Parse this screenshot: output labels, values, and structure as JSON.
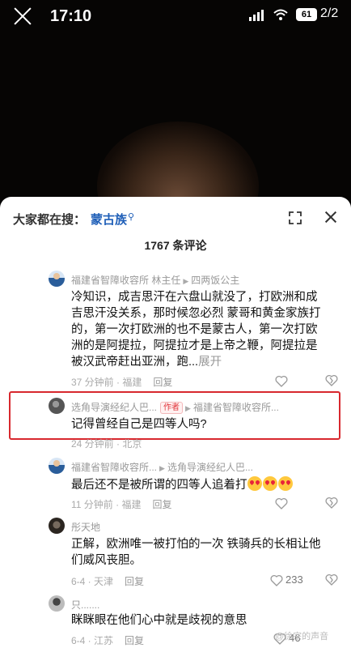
{
  "status_bar": {
    "time": "17:10",
    "battery": "61",
    "page_indicator": "2/2"
  },
  "sheet": {
    "search_label": "大家都在搜：",
    "search_term": "蒙古族",
    "comment_count": "1767 条评论"
  },
  "comments": [
    {
      "user": "福建省智障收容所 林主任",
      "reply_to": "四两饭公主",
      "lines": [
        "冷知识，成吉思汗在六盘山就没了，打欧洲和成",
        "吉思汗没关系，那时候忽必烈 蒙哥和黄金家族打",
        "的，第一次打欧洲的也不是蒙古人，第一次打欧",
        "洲的是阿提拉，阿提拉才是上帝之鞭，阿提拉是",
        "被汉武帝赶出亚洲，跑..."
      ],
      "expand": "展开",
      "time_loc": "37 分钟前 · 福建",
      "reply": "回复"
    },
    {
      "user": "选角导演经纪人巴...",
      "tag": "作者",
      "reply_to": "福建省智障收容所...",
      "text": "记得曾经自己是四等人吗?",
      "time_loc": "24 分钟前 · 北京"
    },
    {
      "user": "福建省智障收容所...",
      "reply_to": "选角导演经纪人巴...",
      "text": "最后还不是被所谓的四等人追着打",
      "time_loc": "11 分钟前 · 福建",
      "reply": "回复"
    },
    {
      "user": "彤天地",
      "lines": [
        "正解，欧洲唯一被打怕的一次 铁骑兵的长相让他",
        "们威风丧胆。"
      ],
      "time_loc": "6-4 · 天津",
      "reply": "回复",
      "likes": "233"
    },
    {
      "user": "只.......",
      "text": "眯眯眼在他们心中就是歧视的意思",
      "time_loc": "6-4 · 江苏",
      "reply": "回复",
      "likes": "46"
    }
  ],
  "watermark": "@徐宗的声音",
  "colors": {
    "accent": "#1f5fb8",
    "highlight": "#d8282e",
    "author_tag": "#e0343a"
  }
}
